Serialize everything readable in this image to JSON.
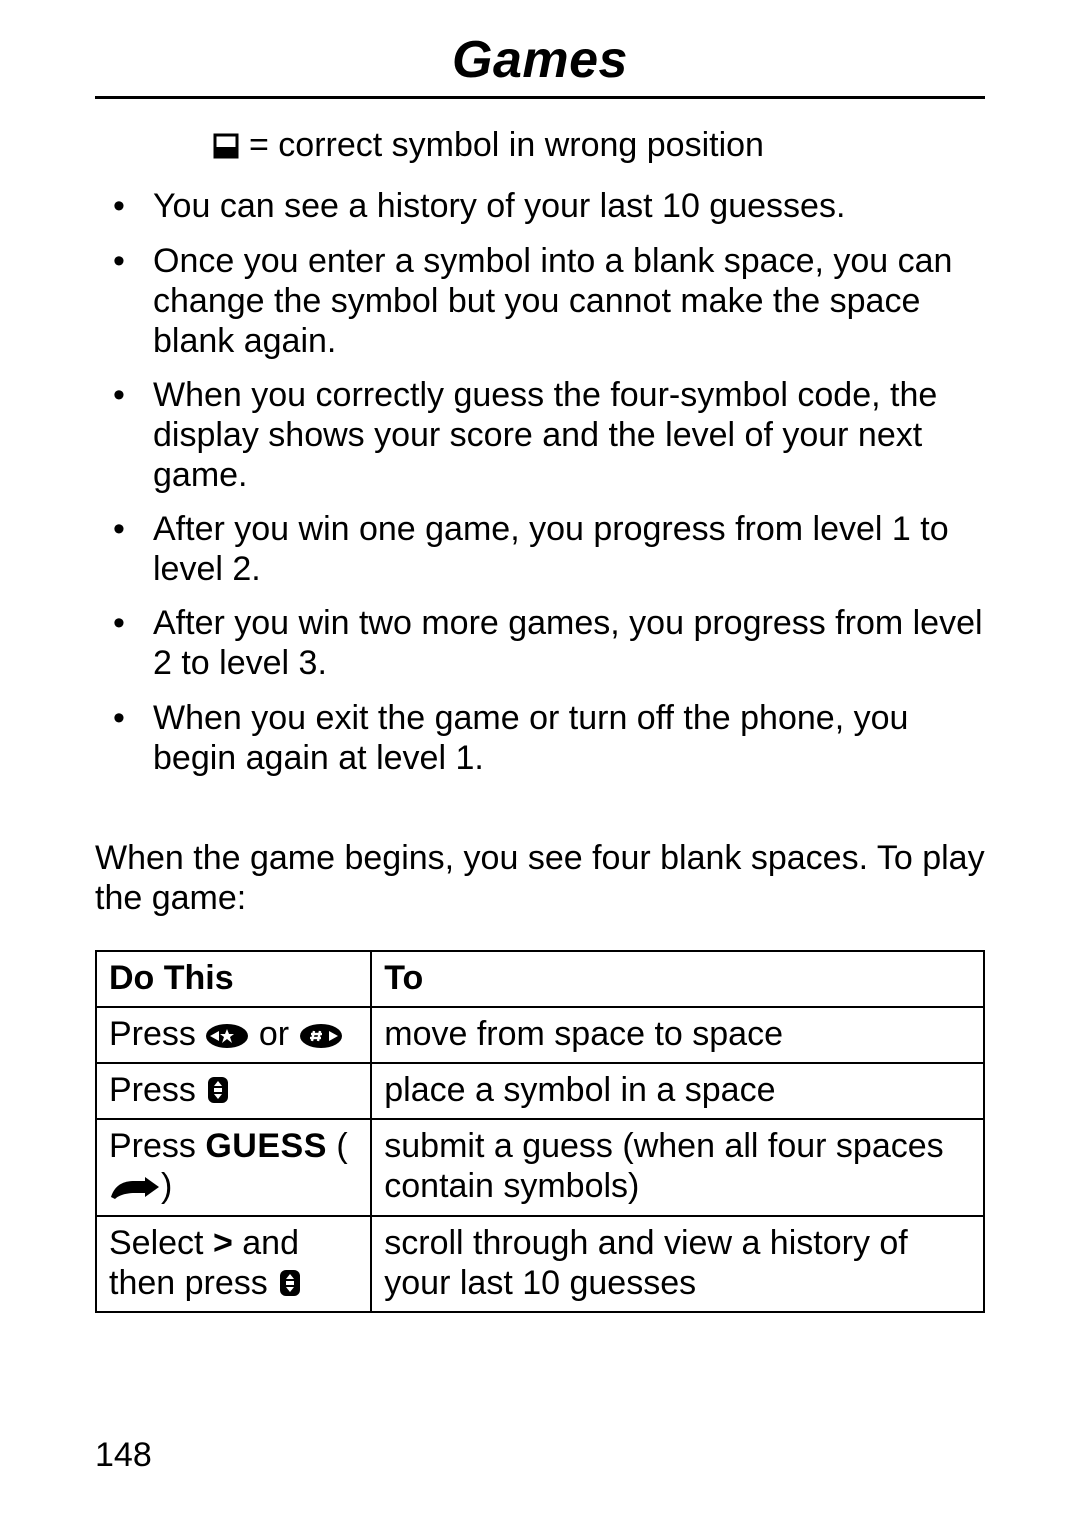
{
  "title": "Games",
  "legend": {
    "text": "= correct symbol in wrong position"
  },
  "bullets": [
    "You can see a history of your last 10 guesses.",
    "Once you enter a symbol into a blank space, you can change the symbol but you cannot make the space blank again.",
    "When you correctly guess the four-symbol code, the display shows your score and the level of your next game.",
    "After you win one game, you progress from level 1 to level 2.",
    "After you win two more games, you progress from level 2 to level 3.",
    "When you exit the game or turn off the phone, you begin again at level 1."
  ],
  "intro": "When the game begins, you see four blank spaces. To play the game:",
  "table": {
    "headers": {
      "do": "Do This",
      "to": "To"
    },
    "rows": [
      {
        "do_pre": "Press ",
        "do_mid": " or ",
        "to": "move from space to space"
      },
      {
        "do_pre": "Press ",
        "to": "place a symbol in a space"
      },
      {
        "do_pre": "Press ",
        "guess": "GUESS",
        "do_open": " (",
        "do_close": ")",
        "to": "submit a guess (when all four spaces contain symbols)"
      },
      {
        "do_pre": "Select ",
        "do_gt": ">",
        "do_mid2": "  and then press ",
        "to": "scroll through and view a history of your last 10 guesses"
      }
    ]
  },
  "page_number": "148"
}
